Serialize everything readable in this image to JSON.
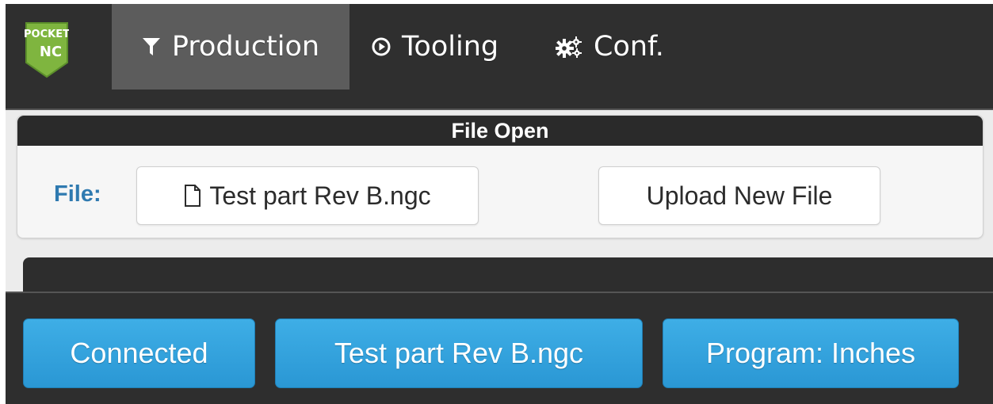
{
  "navbar": {
    "logo_text_top": "POCKET",
    "logo_text_bottom": "NC",
    "items": [
      {
        "label": "Production",
        "icon": "filter-icon",
        "active": true
      },
      {
        "label": "Tooling",
        "icon": "play-circle-icon",
        "active": false
      },
      {
        "label": "Conf.",
        "icon": "gears-icon",
        "active": false
      }
    ],
    "active_bg": "#5c5c5c"
  },
  "file_open_panel": {
    "title": "File Open",
    "file_label": "File:",
    "current_file": "Test part Rev B.ngc",
    "upload_label": "Upload New File"
  },
  "statusbar": {
    "connection": "Connected",
    "loaded_file": "Test part Rev B.ngc",
    "units": "Program: Inches",
    "accent": "#2a9fd8"
  }
}
